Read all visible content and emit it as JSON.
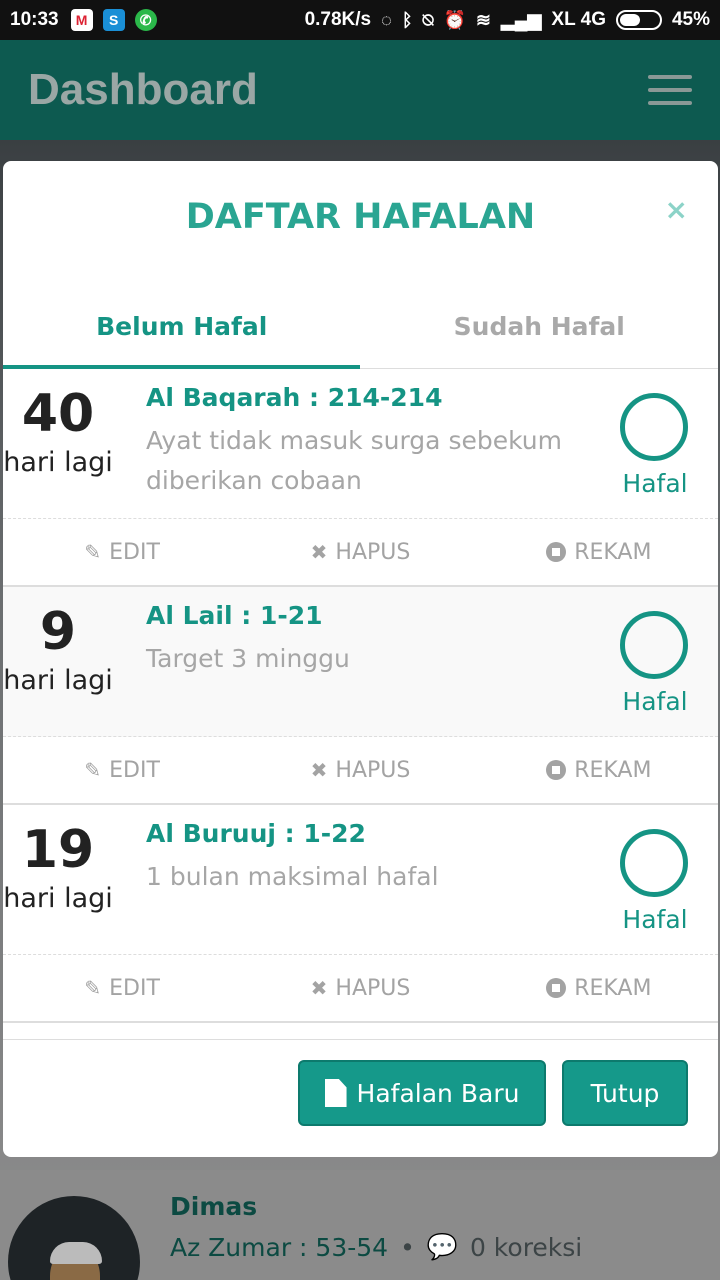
{
  "status_bar": {
    "time": "10:33",
    "speed": "0.78K/s",
    "network": "XL 4G",
    "battery": "45%"
  },
  "app_bar": {
    "title": "Dashboard"
  },
  "modal": {
    "title": "DAFTAR HAFALAN",
    "close_icon": "×",
    "tabs": [
      {
        "label": "Belum Hafal",
        "active": true
      },
      {
        "label": "Sudah Hafal",
        "active": false
      }
    ],
    "items": [
      {
        "days": "40",
        "days_label": "hari lagi",
        "surah": "Al Baqarah : 214-214",
        "note": "Ayat tidak masuk surga sebekum diberikan cobaan",
        "status": "Hafal"
      },
      {
        "days": "9",
        "days_label": "hari lagi",
        "surah": "Al Lail : 1-21",
        "note": "Target 3 minggu",
        "status": "Hafal"
      },
      {
        "days": "19",
        "days_label": "hari lagi",
        "surah": "Al Buruuj : 1-22",
        "note": "1 bulan maksimal hafal",
        "status": "Hafal"
      }
    ],
    "actions": {
      "edit": "EDIT",
      "hapus": "HAPUS",
      "rekam": "REKAM"
    },
    "buttons": {
      "new": "Hafalan Baru",
      "close": "Tutup"
    }
  },
  "background_profile": {
    "name": "Dimas",
    "surah": "Az Zumar : 53-54",
    "bullet": "•",
    "corrections": "0 koreksi"
  },
  "colors": {
    "accent": "#159484",
    "title": "#2aa592",
    "appbar": "#0d5a50"
  }
}
